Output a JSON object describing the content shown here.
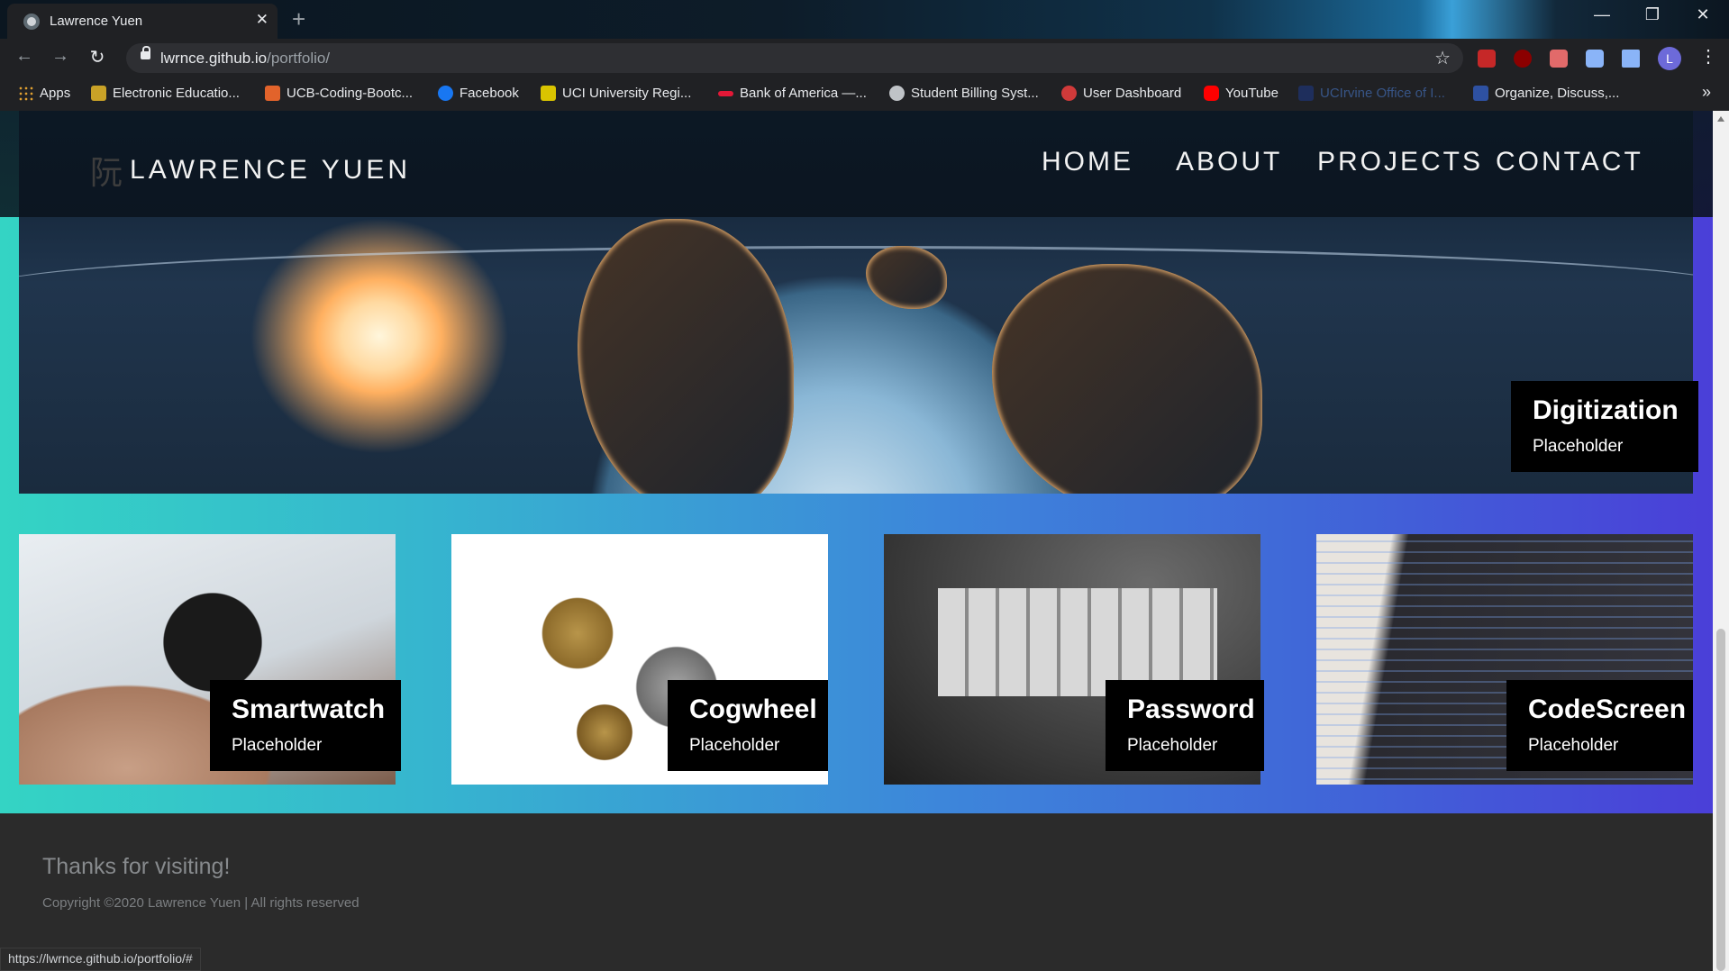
{
  "browser": {
    "tab_title": "Lawrence Yuen",
    "tab_close": "✕",
    "new_tab": "+",
    "url_host": "lwrnce.github.io",
    "url_path": "/portfolio/",
    "window_controls": {
      "minimize": "—",
      "restore": "❐",
      "close": "✕"
    },
    "profile_initial": "L",
    "bookmarks": [
      {
        "label": "Apps",
        "icon": "apps-grid-icon",
        "color": "#e0a030"
      },
      {
        "label": "Electronic Educatio...",
        "icon": "bookmark-favicon-icon",
        "color": "#c9a227"
      },
      {
        "label": "UCB-Coding-Bootc...",
        "icon": "gitlab-icon",
        "color": "#e2632b"
      },
      {
        "label": "Facebook",
        "icon": "facebook-icon",
        "color": "#1877f2"
      },
      {
        "label": "UCI University Regi...",
        "icon": "reg-icon",
        "color": "#d9c400"
      },
      {
        "label": "Bank of America —...",
        "icon": "bank-icon",
        "color": "#e31837"
      },
      {
        "label": "Student Billing Syst...",
        "icon": "globe-icon",
        "color": "#bfc3c7"
      },
      {
        "label": "User Dashboard",
        "icon": "dashboard-icon",
        "color": "#d03a3a"
      },
      {
        "label": "YouTube",
        "icon": "youtube-icon",
        "color": "#ff0000"
      },
      {
        "label": "UCIrvine Office of I...",
        "icon": "uci-icon",
        "color": "#1e3a8a"
      },
      {
        "label": "Organize, Discuss,...",
        "icon": "mal-icon",
        "color": "#2e51a2"
      }
    ],
    "bookmarks_more": "»",
    "status_url": "https://lwrnce.github.io/portfolio/#"
  },
  "site": {
    "brand_glyph": "阮",
    "brand_name": "LAWRENCE YUEN",
    "nav": [
      "HOME",
      "ABOUT",
      "PROJECTS",
      "CONTACT"
    ],
    "hero": {
      "title": "Digitization",
      "subtitle": "Placeholder"
    },
    "cards": [
      {
        "title": "Smartwatch",
        "subtitle": "Placeholder"
      },
      {
        "title": "Cogwheel",
        "subtitle": "Placeholder"
      },
      {
        "title": "Password",
        "subtitle": "Placeholder"
      },
      {
        "title": "CodeScreen",
        "subtitle": "Placeholder"
      }
    ],
    "footer": {
      "thanks": "Thanks for visiting!",
      "copyright": "Copyright ©2020 Lawrence Yuen | All rights reserved"
    },
    "colors": {
      "gradient_start": "#34d4c4",
      "gradient_end": "#4a3fd8",
      "footer_bg": "#2b2b2b"
    }
  }
}
